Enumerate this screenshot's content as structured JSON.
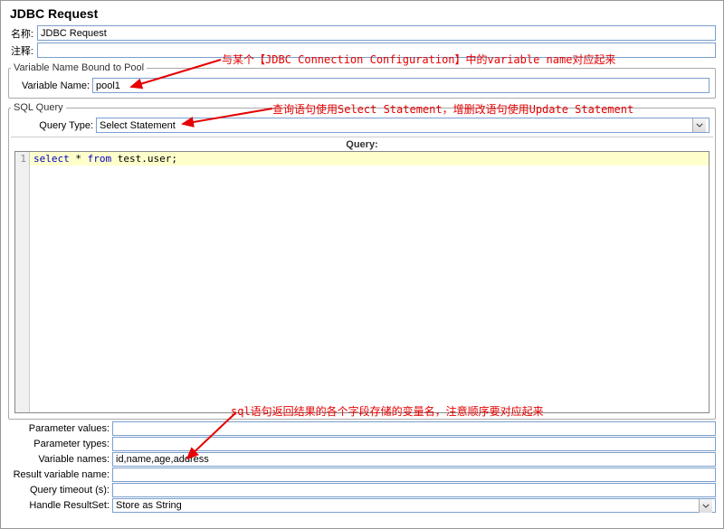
{
  "title": "JDBC Request",
  "name_label": "名称:",
  "name_value": "JDBC Request",
  "comment_label": "注释:",
  "comment_value": "",
  "pool_group": {
    "legend": "Variable Name Bound to Pool",
    "var_label": "Variable Name:",
    "var_value": "pool1"
  },
  "sql_group": {
    "legend": "SQL Query",
    "query_type_label": "Query Type:",
    "query_type_value": "Select Statement",
    "query_header": "Query:",
    "line_no": "1",
    "kw_select": "select",
    "code_rest": " * ",
    "kw_from": "from",
    "code_rest2": " test.user;"
  },
  "footer": {
    "param_values_label": "Parameter values:",
    "param_values": "",
    "param_types_label": "Parameter types:",
    "param_types": "",
    "var_names_label": "Variable names:",
    "var_names": "id,name,age,address",
    "result_var_label": "Result variable name:",
    "result_var": "",
    "query_timeout_label": "Query timeout (s):",
    "query_timeout": "",
    "handle_rs_label": "Handle ResultSet:",
    "handle_rs_value": "Store as String"
  },
  "annotations": {
    "a1": "与某个【JDBC Connection Configuration】中的variable name对应起来",
    "a2": "查询语句使用Select Statement，增删改语句使用Update Statement",
    "a3": "sql语句返回结果的各个字段存储的变量名，注意顺序要对应起来"
  }
}
